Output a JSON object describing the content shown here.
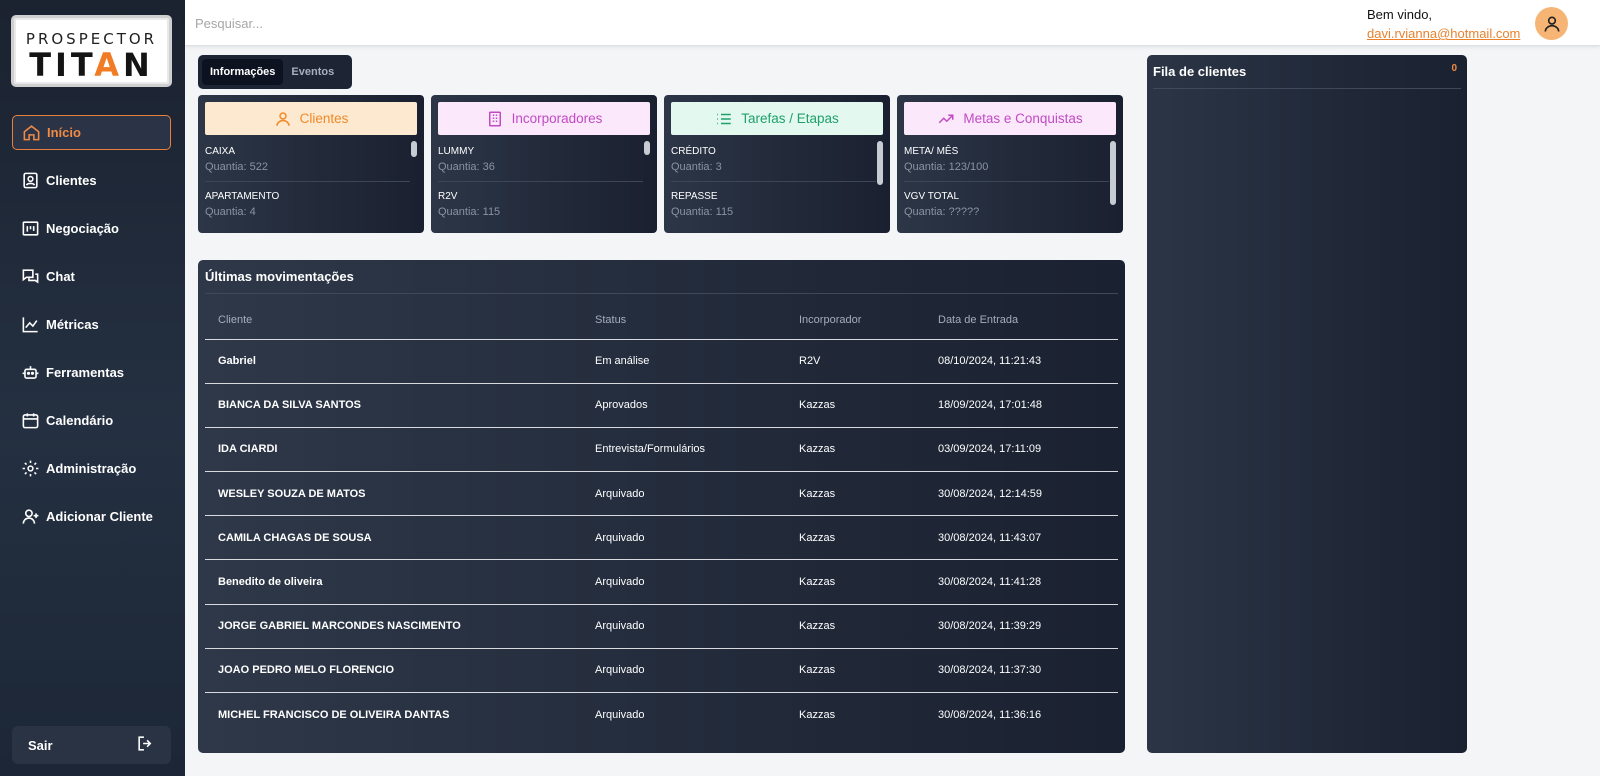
{
  "logo": {
    "line1": "PROSPECTOR",
    "line2_part1": "TIT",
    "line2_star": "A",
    "line2_part2": "N"
  },
  "sidebar": {
    "items": [
      {
        "label": "Início",
        "icon": "home-icon"
      },
      {
        "label": "Clientes",
        "icon": "contact-icon"
      },
      {
        "label": "Negociação",
        "icon": "board-icon"
      },
      {
        "label": "Chat",
        "icon": "chat-icon"
      },
      {
        "label": "Métricas",
        "icon": "chart-icon"
      },
      {
        "label": "Ferramentas",
        "icon": "robot-icon"
      },
      {
        "label": "Calendário",
        "icon": "calendar-icon"
      },
      {
        "label": "Administração",
        "icon": "gear-icon"
      },
      {
        "label": "Adicionar Cliente",
        "icon": "user-plus-icon"
      }
    ],
    "logout_label": "Sair"
  },
  "header": {
    "search_placeholder": "Pesquisar...",
    "welcome": "Bem vindo,",
    "email": "davi.rvianna@hotmail.com"
  },
  "tabs": [
    {
      "label": "Informações",
      "active": true
    },
    {
      "label": "Eventos",
      "active": false
    }
  ],
  "cards": [
    {
      "title": "Clientes",
      "color": "#f08a28",
      "bg": "#fde9cf",
      "items": [
        {
          "name": "CAIXA",
          "qty": "Quantia: 522"
        },
        {
          "name": "APARTAMENTO",
          "qty": "Quantia: 4"
        }
      ]
    },
    {
      "title": "Incorporadores",
      "color": "#c24ac4",
      "bg": "#fbe8fb",
      "items": [
        {
          "name": "LUMMY",
          "qty": "Quantia: 36"
        },
        {
          "name": "R2V",
          "qty": "Quantia: 115"
        }
      ]
    },
    {
      "title": "Tarefas / Etapas",
      "color": "#1fa06b",
      "bg": "#e3f8ef",
      "items": [
        {
          "name": "CRÉDITO",
          "qty": "Quantia: 3"
        },
        {
          "name": "REPASSE",
          "qty": "Quantia: 115"
        }
      ]
    },
    {
      "title": "Metas e Conquistas",
      "color": "#c24ac4",
      "bg": "#fbe8fb",
      "items": [
        {
          "name": "META/ MÊS",
          "qty": "Quantia: 123/100"
        },
        {
          "name": "VGV TOTAL",
          "qty": "Quantia: ?????"
        }
      ]
    }
  ],
  "movements": {
    "title": "Últimas movimentações",
    "columns": [
      "Cliente",
      "Status",
      "Incorporador",
      "Data de Entrada"
    ],
    "rows": [
      [
        "Gabriel",
        "Em análise",
        "R2V",
        "08/10/2024, 11:21:43"
      ],
      [
        "BIANCA DA SILVA SANTOS",
        "Aprovados",
        "Kazzas",
        "18/09/2024, 17:01:48"
      ],
      [
        "IDA CIARDI",
        "Entrevista/Formulários",
        "Kazzas",
        "03/09/2024, 17:11:09"
      ],
      [
        "WESLEY SOUZA DE MATOS",
        "Arquivado",
        "Kazzas",
        "30/08/2024, 12:14:59"
      ],
      [
        "CAMILA CHAGAS DE SOUSA",
        "Arquivado",
        "Kazzas",
        "30/08/2024, 11:43:07"
      ],
      [
        "Benedito de oliveira",
        "Arquivado",
        "Kazzas",
        "30/08/2024, 11:41:28"
      ],
      [
        "JORGE GABRIEL MARCONDES NASCIMENTO",
        "Arquivado",
        "Kazzas",
        "30/08/2024, 11:39:29"
      ],
      [
        "JOAO PEDRO MELO FLORENCIO",
        "Arquivado",
        "Kazzas",
        "30/08/2024, 11:37:30"
      ],
      [
        "MICHEL FRANCISCO DE OLIVEIRA DANTAS",
        "Arquivado",
        "Kazzas",
        "30/08/2024, 11:36:16"
      ]
    ]
  },
  "queue": {
    "title": "Fila de clientes",
    "count": "0"
  },
  "colors": {
    "accent": "#f08a44",
    "sidebar": "#1f2838",
    "panel": "#222b3b"
  }
}
